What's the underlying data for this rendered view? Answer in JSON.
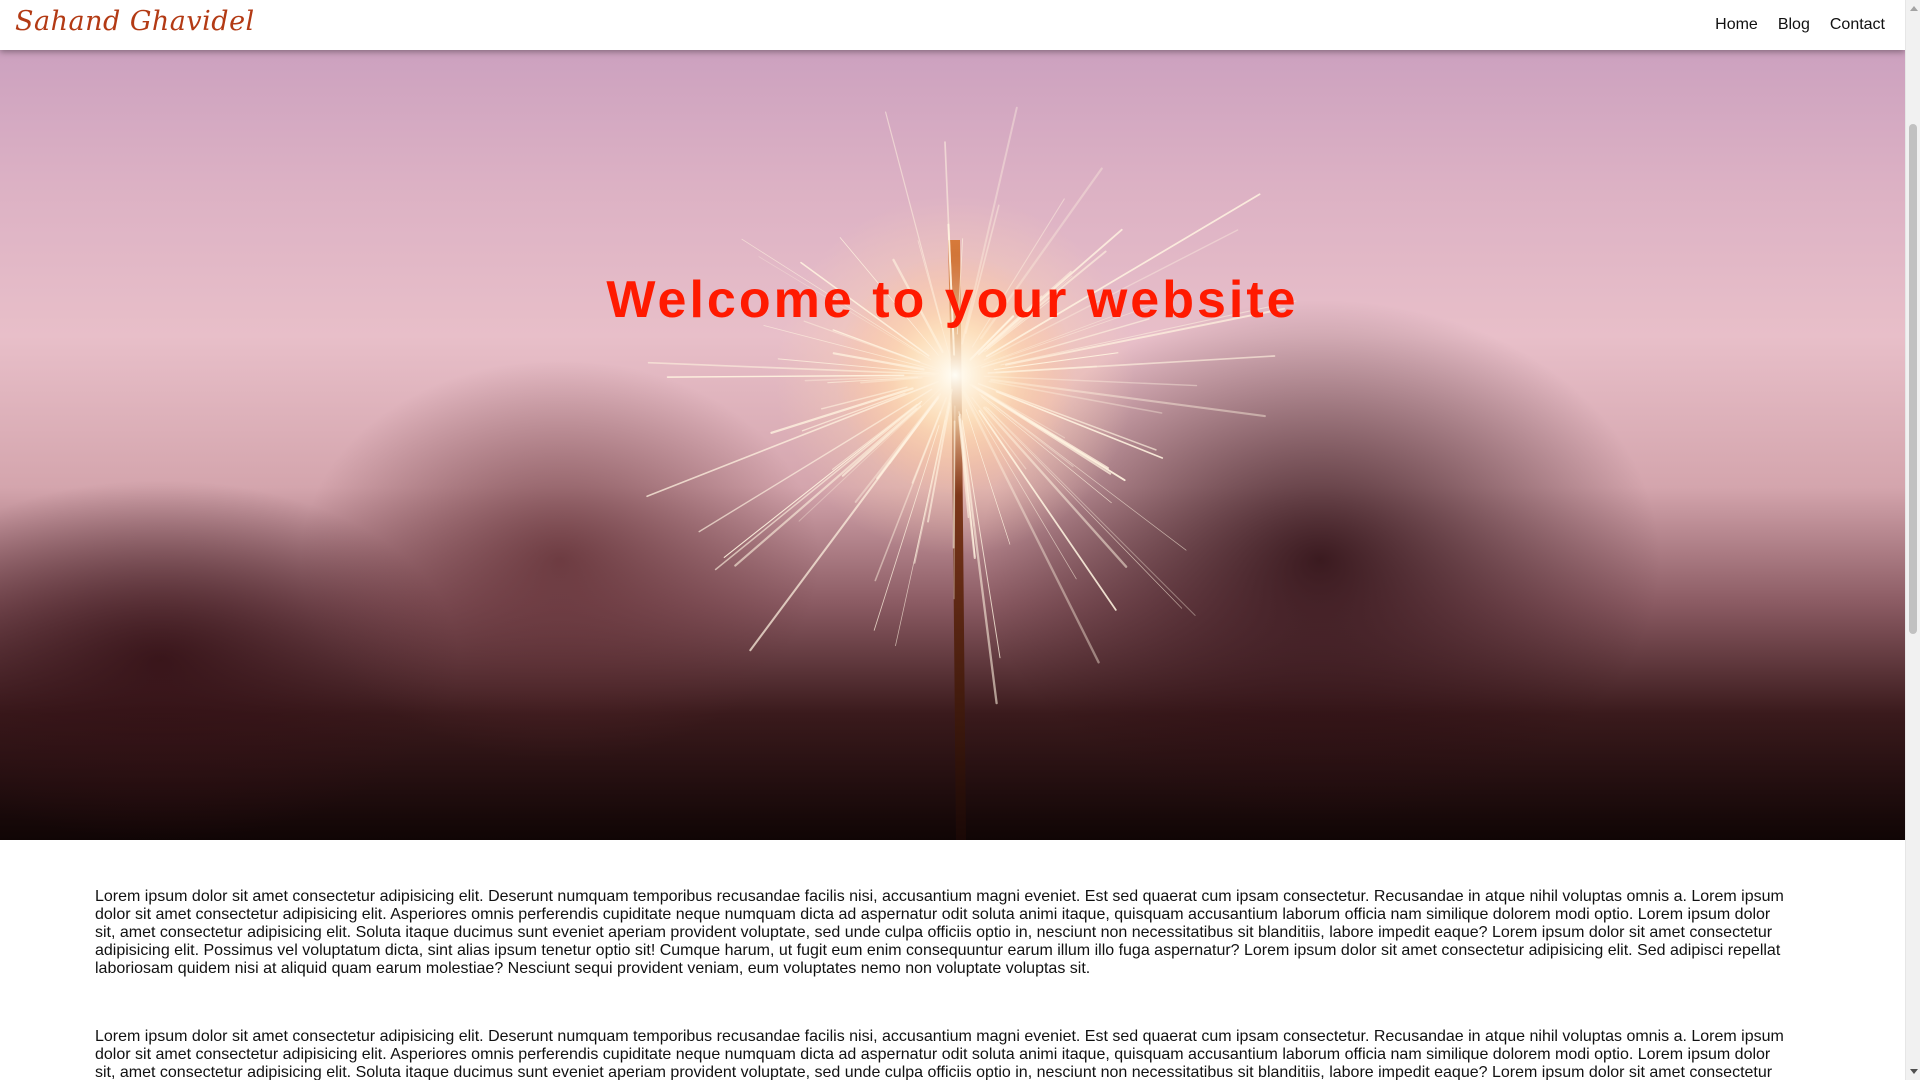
{
  "navbar": {
    "logo_text": "Sahand Ghavidel",
    "links": [
      {
        "label": "Home"
      },
      {
        "label": "Blog"
      },
      {
        "label": "Contact"
      }
    ]
  },
  "hero": {
    "title": "Welcome to your website",
    "title_color": "#ff1a00"
  },
  "content": {
    "paragraphs": [
      "Lorem ipsum dolor sit amet consectetur adipisicing elit. Deserunt numquam temporibus recusandae facilis nisi, accusantium magni eveniet. Est sed quaerat cum ipsam consectetur. Recusandae in atque nihil voluptas omnis a. Lorem ipsum dolor sit amet consectetur adipisicing elit. Asperiores omnis perferendis cupiditate neque numquam dicta ad aspernatur odit soluta animi itaque, quisquam accusantium laborum officia nam similique dolorem modi optio. Lorem ipsum dolor sit, amet consectetur adipisicing elit. Soluta itaque ducimus sunt eveniet aperiam provident voluptate, sed unde culpa officiis optio in, nesciunt non necessitatibus sit blanditiis, labore impedit eaque? Lorem ipsum dolor sit amet consectetur adipisicing elit. Possimus vel voluptatum dicta, sint alias ipsum tenetur optio sit! Cumque harum, ut fugit eum enim consequuntur earum illum illo fuga aspernatur? Lorem ipsum dolor sit amet consectetur adipisicing elit. Sed adipisci repellat laboriosam quidem nisi at aliquid quam earum molestiae? Nesciunt sequi provident veniam, eum voluptates nemo non voluptate voluptas sit.",
      "Lorem ipsum dolor sit amet consectetur adipisicing elit. Deserunt numquam temporibus recusandae facilis nisi, accusantium magni eveniet. Est sed quaerat cum ipsam consectetur. Recusandae in atque nihil voluptas omnis a. Lorem ipsum dolor sit amet consectetur adipisicing elit. Asperiores omnis perferendis cupiditate neque numquam dicta ad aspernatur odit soluta animi itaque, quisquam accusantium laborum officia nam similique dolorem modi optio. Lorem ipsum dolor sit, amet consectetur adipisicing elit. Soluta itaque ducimus sunt eveniet aperiam provident voluptate, sed unde culpa officiis optio in, nesciunt non necessitatibus sit blanditiis, labore impedit eaque? Lorem ipsum dolor sit amet consectetur"
    ]
  },
  "scrollbar": {
    "up_icon": "chevron-up-icon",
    "down_icon": "chevron-down-icon"
  }
}
